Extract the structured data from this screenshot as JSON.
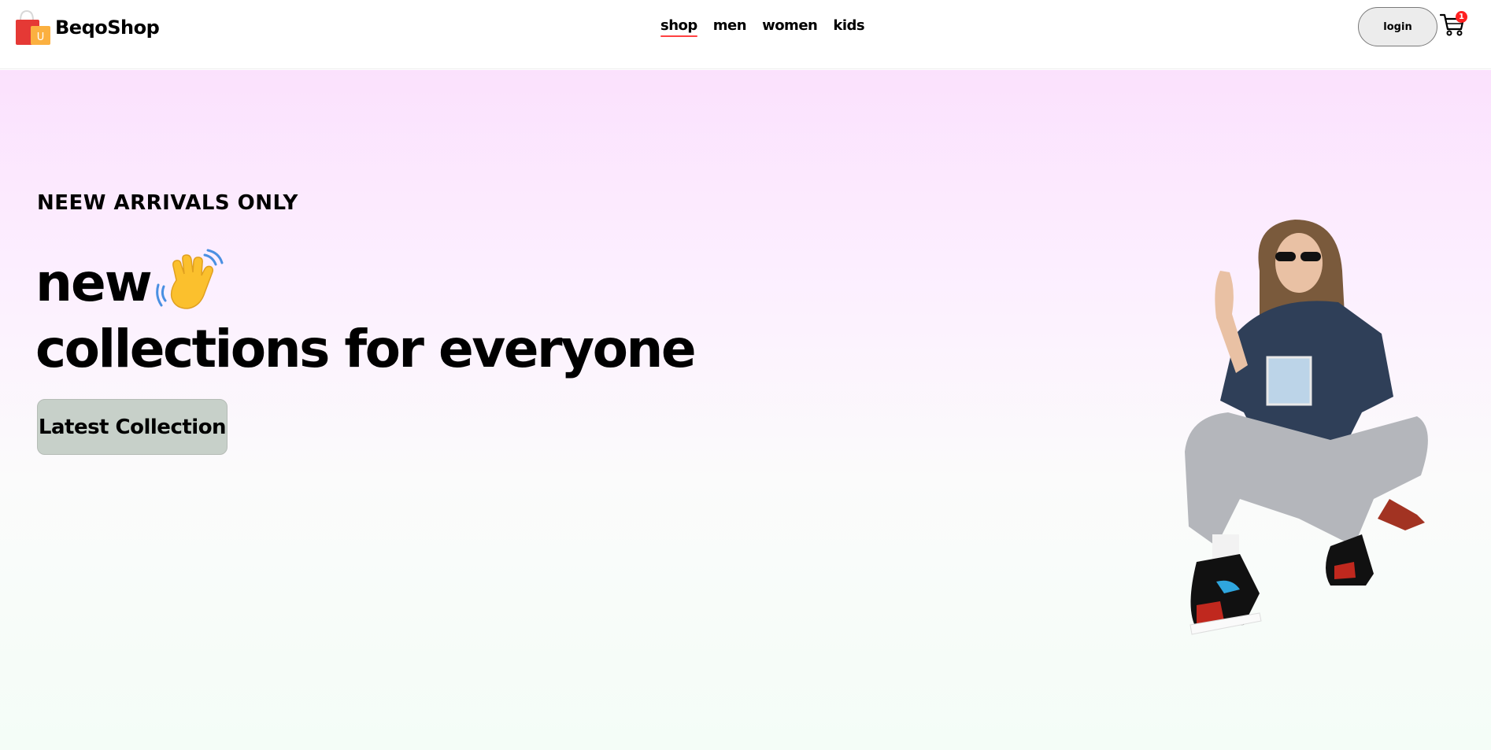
{
  "brand": {
    "name": "BeqoShop",
    "logo_icon": "shopping-bags-icon"
  },
  "nav": {
    "items": [
      {
        "label": "shop",
        "active": true
      },
      {
        "label": "men",
        "active": false
      },
      {
        "label": "women",
        "active": false
      },
      {
        "label": "kids",
        "active": false
      }
    ]
  },
  "header": {
    "login_label": "login",
    "cart_count": "1",
    "cart_icon": "cart-icon"
  },
  "hero": {
    "tagline": "NEEW ARRIVALS ONLY",
    "line1": "new",
    "line2": "collections for everyone",
    "cta_label": "Latest Collection",
    "emoji_icon": "waving-hand-icon",
    "image": "hero-model-image"
  },
  "colors": {
    "accent": "#ff4141",
    "hero_top": "#fbe1fd",
    "hero_bottom": "#f4fdf7",
    "cta_bg": "#c7d0c9",
    "badge": "#ff2020"
  }
}
